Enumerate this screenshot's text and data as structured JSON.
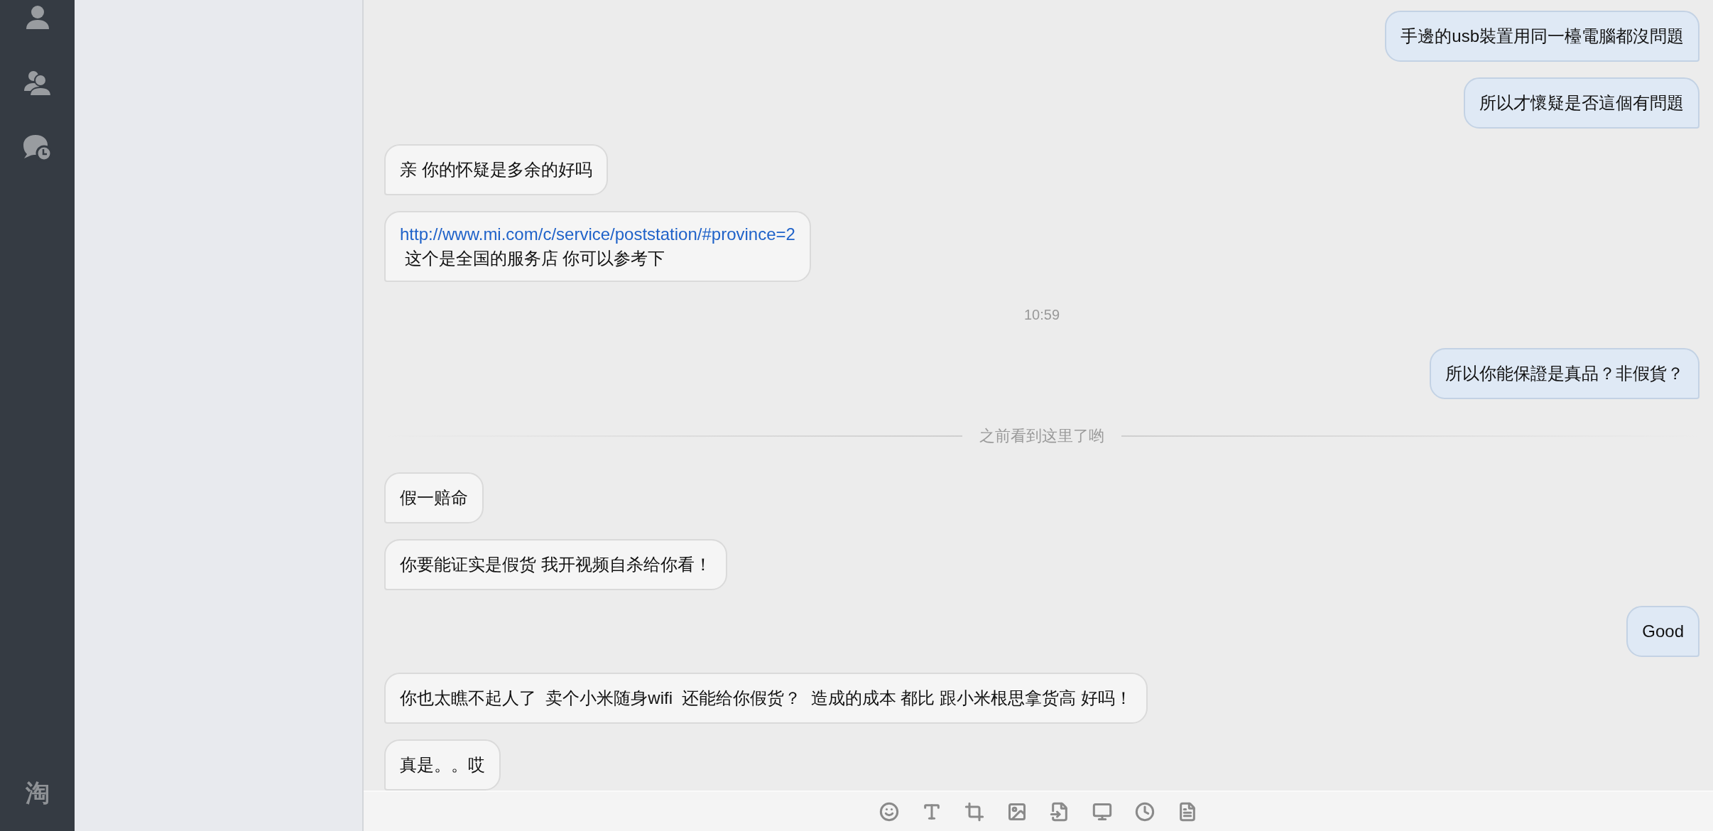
{
  "sidebar": {
    "logo": "淘"
  },
  "messages": [
    {
      "kind": "sent",
      "text": "手邊的usb裝置用同一檯電腦都沒問題"
    },
    {
      "kind": "sent",
      "text": "所以才懷疑是否這個有問題"
    },
    {
      "kind": "received",
      "text": "亲 你的怀疑是多余的好吗"
    },
    {
      "kind": "received",
      "link": "http://www.mi.com/c/service/poststation/#province=2",
      "text": " 这个是全国的服务店 你可以参考下"
    },
    {
      "kind": "time",
      "text": "10:59"
    },
    {
      "kind": "sent",
      "text": "所以你能保證是真品？非假貨？"
    },
    {
      "kind": "divider",
      "text": "之前看到这里了哟"
    },
    {
      "kind": "received",
      "text": "假一赔命"
    },
    {
      "kind": "received",
      "text": "你要能证实是假货 我开视频自杀给你看！"
    },
    {
      "kind": "sent",
      "text": "Good"
    },
    {
      "kind": "received",
      "text": "你也太瞧不起人了  卖个小米随身wifi  还能给你假货？  造成的成本 都比 跟小米根思拿货高 好吗！"
    },
    {
      "kind": "received",
      "text": "真是。。哎"
    }
  ]
}
